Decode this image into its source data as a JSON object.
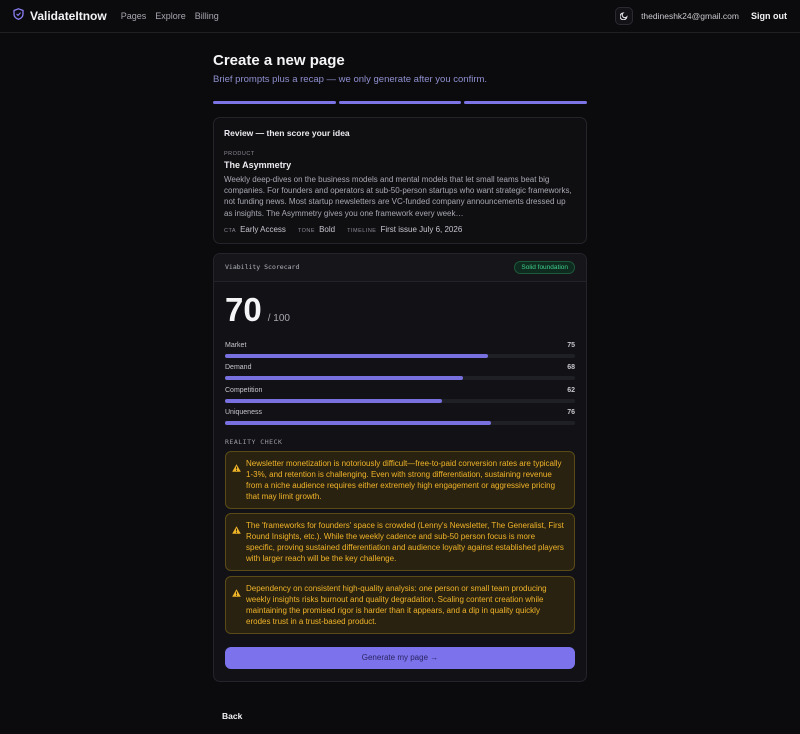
{
  "header": {
    "brand": "ValidateItnow",
    "nav": [
      "Pages",
      "Explore",
      "Billing"
    ],
    "email": "thedineshk24@gmail.com",
    "signout": "Sign out"
  },
  "page": {
    "title": "Create a new page",
    "subtitle": "Brief prompts plus a recap — we only generate after you confirm."
  },
  "review": {
    "title": "Review — then score your idea",
    "product_label": "PRODUCT",
    "product_name": "The Asymmetry",
    "description": "Weekly deep-dives on the business models and mental models that let small teams beat big companies. For founders and operators at sub-50-person startups who want strategic frameworks, not funding news. Most startup newsletters are VC-funded company announcements dressed up as insights. The Asymmetry gives you one framework every week…",
    "cta_label": "CTA",
    "cta_value": "Early Access",
    "tone_label": "TONE",
    "tone_value": "Bold",
    "timeline_label": "TIMELINE",
    "timeline_value": "First issue July 6, 2026"
  },
  "scorecard": {
    "title": "Viability Scorecard",
    "badge": "Solid foundation",
    "score": "70",
    "total": "/ 100",
    "metrics": [
      {
        "label": "Market",
        "value": "75",
        "fraction": 0.75
      },
      {
        "label": "Demand",
        "value": "68",
        "fraction": 0.68
      },
      {
        "label": "Competition",
        "value": "62",
        "fraction": 0.62
      },
      {
        "label": "Uniqueness",
        "value": "76",
        "fraction": 0.76
      }
    ],
    "reality_label": "REALITY CHECK",
    "warnings": [
      "Newsletter monetization is notoriously difficult—free-to-paid conversion rates are typically 1-3%, and retention is challenging. Even with strong differentiation, sustaining revenue from a niche audience requires either extremely high engagement or aggressive pricing that may limit growth.",
      "The 'frameworks for founders' space is crowded (Lenny's Newsletter, The Generalist, First Round Insights, etc.). While the weekly cadence and sub-50 person focus is more specific, proving sustained differentiation and audience loyalty against established players with larger reach will be the key challenge.",
      "Dependency on consistent high-quality analysis: one person or small team producing weekly insights risks burnout and quality degradation. Scaling content creation while maintaining the promised rigor is harder than it appears, and a dip in quality quickly erodes trust in a trust-based product."
    ],
    "generate_label": "Generate my page →"
  },
  "footer": {
    "back": "Back"
  },
  "colors": {
    "accent": "#7c72ec",
    "warning": "#f0b429",
    "success": "#3fd08c"
  },
  "icons": [
    "shield-icon",
    "moon-icon",
    "warning-icon"
  ]
}
